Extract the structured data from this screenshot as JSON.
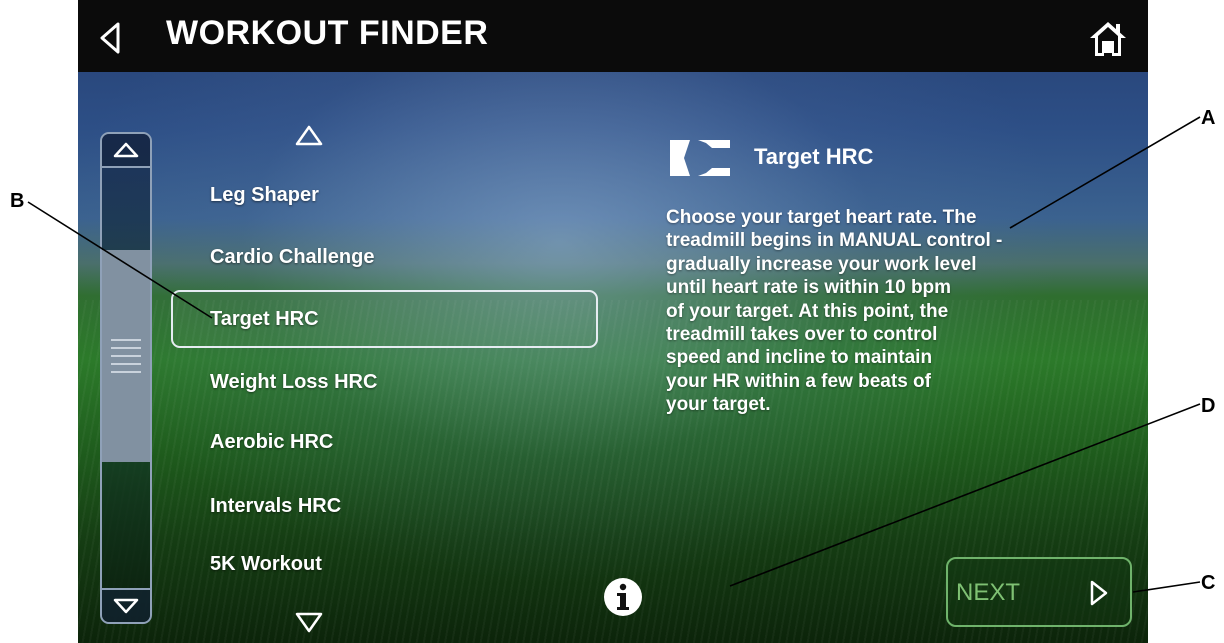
{
  "header": {
    "title": "WORKOUT FINDER",
    "back_icon": "back-arrow-icon",
    "home_icon": "home-icon"
  },
  "scrollbar": {
    "up_icon": "scroll-up-arrow-icon",
    "down_icon": "scroll-down-arrow-icon"
  },
  "workout_list": {
    "up_icon": "list-up-arrow-icon",
    "down_icon": "list-down-arrow-icon",
    "selected": "Target HRC",
    "items": [
      {
        "label": "Leg Shaper"
      },
      {
        "label": "Cardio Challenge"
      },
      {
        "label": "Target HRC"
      },
      {
        "label": "Weight Loss HRC"
      },
      {
        "label": "Aerobic HRC"
      },
      {
        "label": "Intervals HRC"
      },
      {
        "label": "5K Workout"
      }
    ]
  },
  "detail": {
    "icon": "heart-rate-icon",
    "title": "Target HRC",
    "lines": [
      "Choose your target heart rate. The",
      "treadmill begins in MANUAL control -",
      "gradually increase your work level",
      "until heart rate is within 10 bpm",
      "of your target. At this point, the",
      "treadmill takes over to control",
      "speed and incline to maintain",
      "your HR within a few beats of",
      "your target."
    ]
  },
  "info_icon": "info-icon",
  "next_button": {
    "label": "NEXT",
    "icon": "next-arrow-icon"
  },
  "callouts": {
    "a": "A",
    "b": "B",
    "c": "C",
    "d": "D"
  },
  "colors": {
    "title_bar": "#0b0b0b",
    "next_green": "#7fc173",
    "selection_border": "#e6ecf2"
  }
}
